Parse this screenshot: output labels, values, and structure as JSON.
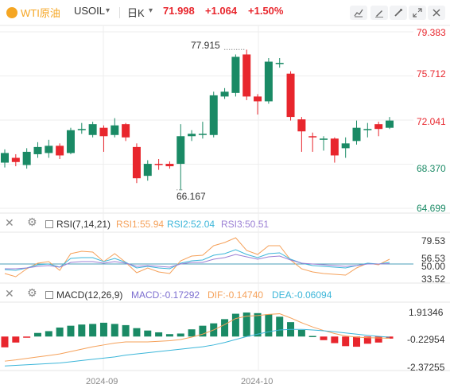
{
  "header": {
    "symbol_name": "WTI原油",
    "symbol_code": "USOIL",
    "symbol_dropdown": "▾",
    "timeframe": "日K",
    "timeframe_dropdown": "▾",
    "last_price": "71.998",
    "change": "+1.064",
    "change_pct": "+1.50%",
    "tool_icons": [
      "line-chart-icon",
      "draw-icon",
      "indicator-icon",
      "expand-icon",
      "close-icon"
    ]
  },
  "colors": {
    "up": "#1a8a65",
    "down": "#e8262d",
    "rsi1": "#f5a15a",
    "rsi2": "#3cb6d9",
    "rsi3": "#9b7fd4",
    "macd": "#7d6fd0",
    "dif": "#f5a15a",
    "dea": "#3cb6d9",
    "grid": "#eeeeee"
  },
  "price_axis": [
    "79.383",
    "75.712",
    "72.041",
    "68.370",
    "64.699"
  ],
  "price_annotations": {
    "high": "77.915",
    "low": "66.167"
  },
  "rsi": {
    "title": "RSI(7,14,21)",
    "rsi1": "RSI1:55.94",
    "rsi2": "RSI2:52.04",
    "rsi3": "RSI3:50.51",
    "axis": [
      "79.53",
      "56.53",
      "50.00",
      "33.52"
    ]
  },
  "macd": {
    "title": "MACD(12,26,9)",
    "macd_value": "MACD:-0.17292",
    "dif_value": "DIF:-0.14740",
    "dea_value": "DEA:-0.06094",
    "axis": [
      "1.91346",
      "-0.22954",
      "-2.37255"
    ]
  },
  "x_axis": [
    "2024-09",
    "2024-10"
  ],
  "chart_data": [
    {
      "type": "candlestick",
      "title": "WTI原油 USOIL 日K",
      "ylim": [
        64.699,
        79.383
      ],
      "y_ticks": [
        79.383,
        75.712,
        72.041,
        68.37,
        64.699
      ],
      "x_labels": [
        "2024-09",
        "2024-10"
      ],
      "annotations": [
        {
          "label": "77.915",
          "value": 77.915
        },
        {
          "label": "66.167",
          "value": 66.167
        }
      ],
      "candles": [
        {
          "o": 68.5,
          "c": 69.3,
          "h": 69.6,
          "l": 68.1
        },
        {
          "o": 68.9,
          "c": 68.55,
          "h": 69.2,
          "l": 68.2
        },
        {
          "o": 68.3,
          "c": 69.4,
          "h": 69.7,
          "l": 68.0
        },
        {
          "o": 69.2,
          "c": 69.8,
          "h": 70.2,
          "l": 68.9
        },
        {
          "o": 69.3,
          "c": 69.9,
          "h": 70.4,
          "l": 68.9
        },
        {
          "o": 69.9,
          "c": 69.1,
          "h": 70.1,
          "l": 68.8
        },
        {
          "o": 69.3,
          "c": 71.2,
          "h": 71.4,
          "l": 69.2
        },
        {
          "o": 71.2,
          "c": 71.3,
          "h": 71.8,
          "l": 70.9
        },
        {
          "o": 70.8,
          "c": 71.7,
          "h": 71.9,
          "l": 70.6
        },
        {
          "o": 71.4,
          "c": 70.7,
          "h": 71.6,
          "l": 69.4
        },
        {
          "o": 70.8,
          "c": 71.6,
          "h": 72.2,
          "l": 70.6
        },
        {
          "o": 71.7,
          "c": 70.6,
          "h": 71.8,
          "l": 70.3
        },
        {
          "o": 69.8,
          "c": 67.2,
          "h": 70.1,
          "l": 66.8
        },
        {
          "o": 67.4,
          "c": 68.4,
          "h": 68.7,
          "l": 67.0
        },
        {
          "o": 68.4,
          "c": 68.3,
          "h": 68.8,
          "l": 67.9
        },
        {
          "o": 68.4,
          "c": 68.2,
          "h": 68.6,
          "l": 68.0
        },
        {
          "o": 68.4,
          "c": 70.7,
          "h": 71.7,
          "l": 66.2
        },
        {
          "o": 70.7,
          "c": 70.9,
          "h": 71.2,
          "l": 70.3
        },
        {
          "o": 70.8,
          "c": 70.9,
          "h": 71.9,
          "l": 70.5
        },
        {
          "o": 70.8,
          "c": 74.1,
          "h": 74.4,
          "l": 70.6
        },
        {
          "o": 74.0,
          "c": 74.4,
          "h": 74.7,
          "l": 73.8
        },
        {
          "o": 74.3,
          "c": 77.3,
          "h": 77.5,
          "l": 74.0
        },
        {
          "o": 77.5,
          "c": 74.0,
          "h": 77.9,
          "l": 73.7
        },
        {
          "o": 74.0,
          "c": 73.6,
          "h": 74.2,
          "l": 72.5
        },
        {
          "o": 73.6,
          "c": 76.9,
          "h": 77.2,
          "l": 73.4
        },
        {
          "o": 76.7,
          "c": 76.8,
          "h": 77.2,
          "l": 76.4
        },
        {
          "o": 75.9,
          "c": 72.3,
          "h": 76.1,
          "l": 72.0
        },
        {
          "o": 72.1,
          "c": 71.1,
          "h": 72.3,
          "l": 69.4
        },
        {
          "o": 70.7,
          "c": 70.6,
          "h": 71.0,
          "l": 69.4
        },
        {
          "o": 70.4,
          "c": 70.5,
          "h": 70.7,
          "l": 69.5
        },
        {
          "o": 70.5,
          "c": 69.1,
          "h": 70.6,
          "l": 68.5
        },
        {
          "o": 69.7,
          "c": 70.1,
          "h": 70.6,
          "l": 68.9
        },
        {
          "o": 70.3,
          "c": 71.4,
          "h": 72.0,
          "l": 70.0
        },
        {
          "o": 71.2,
          "c": 71.3,
          "h": 71.8,
          "l": 70.6
        },
        {
          "o": 71.7,
          "c": 71.3,
          "h": 71.9,
          "l": 70.7
        },
        {
          "o": 71.4,
          "c": 72.0,
          "h": 72.3,
          "l": 71.3
        }
      ]
    },
    {
      "type": "line",
      "title": "RSI(7,14,21)",
      "y_ticks": [
        79.53,
        56.53,
        50.0,
        33.52
      ],
      "ylim": [
        28,
        86
      ],
      "series": [
        {
          "name": "RSI1",
          "values": [
            38,
            34,
            44,
            51,
            53,
            42,
            63,
            66,
            65,
            53,
            63,
            52,
            39,
            45,
            40,
            38,
            54,
            60,
            61,
            73,
            77,
            83,
            67,
            62,
            73,
            73,
            55,
            44,
            40,
            38,
            37,
            36,
            45,
            51,
            49,
            56
          ]
        },
        {
          "name": "RSI2",
          "values": [
            43,
            42,
            45,
            49,
            50,
            46,
            57,
            58,
            58,
            53,
            57,
            52,
            45,
            47,
            45,
            44,
            51,
            54,
            55,
            61,
            63,
            68,
            62,
            58,
            63,
            64,
            56,
            51,
            48,
            47,
            46,
            45,
            48,
            51,
            50,
            52
          ]
        },
        {
          "name": "RSI3",
          "values": [
            44,
            44,
            45,
            47,
            48,
            46,
            52,
            53,
            53,
            51,
            53,
            51,
            47,
            48,
            47,
            46,
            50,
            52,
            52,
            56,
            58,
            62,
            59,
            56,
            59,
            60,
            55,
            51,
            50,
            49,
            48,
            47,
            48,
            50,
            50,
            50.5
          ]
        }
      ]
    },
    {
      "type": "bar+line",
      "title": "MACD(12,26,9)",
      "y_ticks": [
        1.91346,
        -0.22954,
        -2.37255
      ],
      "ylim": [
        -2.7,
        2.6
      ],
      "series": [
        {
          "name": "MACD",
          "values": [
            -0.9,
            -0.5,
            -0.05,
            0.3,
            0.45,
            0.75,
            0.9,
            1.0,
            1.05,
            1.15,
            1.05,
            0.95,
            0.7,
            0.5,
            0.35,
            0.2,
            0.25,
            0.6,
            0.9,
            1.1,
            1.45,
            1.9,
            2.0,
            1.95,
            1.85,
            1.65,
            1.2,
            0.55,
            0.05,
            -0.3,
            -0.55,
            -0.8,
            -0.85,
            -0.6,
            -0.5,
            -0.17292
          ]
        },
        {
          "name": "DIF",
          "values": [
            -2.05,
            -1.95,
            -1.82,
            -1.7,
            -1.58,
            -1.45,
            -1.25,
            -1.05,
            -0.85,
            -0.7,
            -0.55,
            -0.45,
            -0.45,
            -0.45,
            -0.4,
            -0.35,
            -0.25,
            -0.05,
            0.2,
            0.55,
            1.0,
            1.5,
            1.7,
            1.75,
            1.85,
            1.9,
            1.55,
            1.15,
            0.8,
            0.5,
            0.25,
            0.05,
            -0.05,
            -0.1,
            -0.12,
            -0.1474
          ]
        },
        {
          "name": "DEA",
          "values": [
            -2.45,
            -2.4,
            -2.35,
            -2.3,
            -2.25,
            -2.2,
            -2.1,
            -2.0,
            -1.9,
            -1.8,
            -1.7,
            -1.55,
            -1.45,
            -1.35,
            -1.25,
            -1.15,
            -1.05,
            -0.95,
            -0.85,
            -0.7,
            -0.5,
            -0.25,
            0.0,
            0.2,
            0.4,
            0.55,
            0.6,
            0.6,
            0.55,
            0.48,
            0.4,
            0.3,
            0.2,
            0.1,
            0.02,
            -0.06094
          ]
        }
      ]
    }
  ]
}
